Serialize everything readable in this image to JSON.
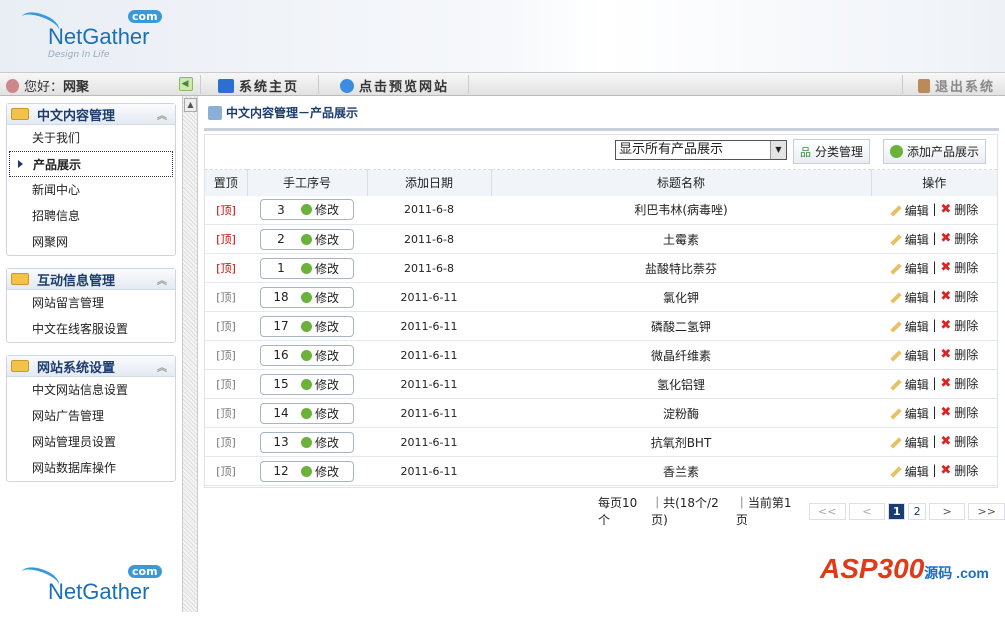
{
  "header": {
    "logo": "NetGather",
    "logo_badge": "com",
    "tagline": "Design In Life"
  },
  "topbar": {
    "greeting": "您好：",
    "user": "网聚",
    "home": "系统主页",
    "preview": "点击预览网站",
    "logout": "退出系统"
  },
  "sidebar": {
    "groups": [
      {
        "title": "中文内容管理",
        "items": [
          "关于我们",
          "产品展示",
          "新闻中心",
          "招聘信息",
          "网聚网"
        ]
      },
      {
        "title": "互动信息管理",
        "items": [
          "网站留言管理",
          "中文在线客服设置"
        ]
      },
      {
        "title": "网站系统设置",
        "items": [
          "中文网站信息设置",
          "网站广告管理",
          "网站管理员设置",
          "网站数据库操作"
        ]
      }
    ],
    "active": "产品展示"
  },
  "main": {
    "title": "中文内容管理－产品展示",
    "filter": "显示所有产品展示",
    "category_btn": "分类管理",
    "add_btn": "添加产品展示",
    "columns": [
      "置顶",
      "手工序号",
      "添加日期",
      "标题名称",
      "操作"
    ],
    "top_label": "[顶]",
    "modify_label": "修改",
    "edit_label": "编辑",
    "delete_label": "删除",
    "rows": [
      {
        "top": true,
        "order": "3",
        "date": "2011-6-8",
        "title": "利巴韦林(病毒唑)"
      },
      {
        "top": true,
        "order": "2",
        "date": "2011-6-8",
        "title": "土霉素"
      },
      {
        "top": true,
        "order": "1",
        "date": "2011-6-8",
        "title": "盐酸特比萘芬"
      },
      {
        "top": false,
        "order": "18",
        "date": "2011-6-11",
        "title": "氯化钾"
      },
      {
        "top": false,
        "order": "17",
        "date": "2011-6-11",
        "title": "磷酸二氢钾"
      },
      {
        "top": false,
        "order": "16",
        "date": "2011-6-11",
        "title": "微晶纤维素"
      },
      {
        "top": false,
        "order": "15",
        "date": "2011-6-11",
        "title": "氢化铝锂"
      },
      {
        "top": false,
        "order": "14",
        "date": "2011-6-11",
        "title": "淀粉酶"
      },
      {
        "top": false,
        "order": "13",
        "date": "2011-6-11",
        "title": "抗氧剂BHT"
      },
      {
        "top": false,
        "order": "12",
        "date": "2011-6-11",
        "title": "香兰素"
      }
    ],
    "pager": {
      "per_page": "每页10个",
      "total": "｜共(18个/2页)",
      "current": "｜当前第1页",
      "first": "<<",
      "prev": "<",
      "pages": [
        "1",
        "2"
      ],
      "next": ">",
      "last": ">>"
    }
  },
  "watermark": {
    "brand": "ASP300",
    "suffix": "源码 .com"
  }
}
